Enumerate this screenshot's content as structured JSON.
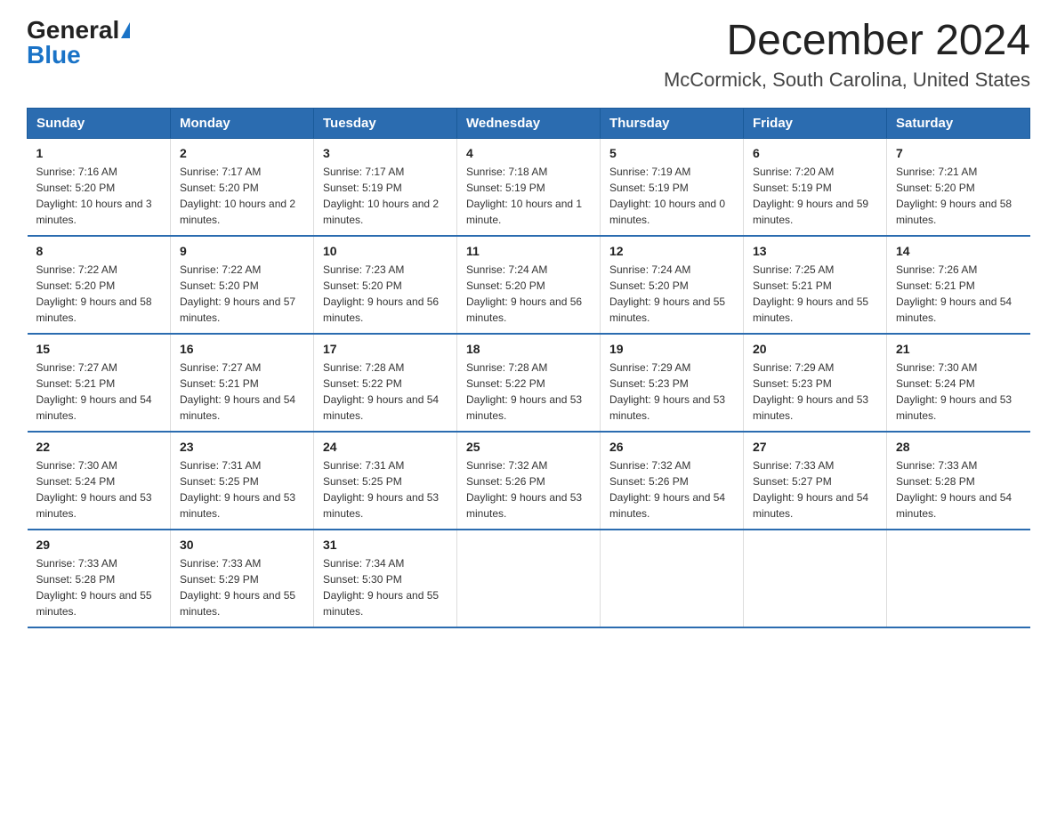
{
  "header": {
    "logo_general": "General",
    "logo_blue": "Blue",
    "month_title": "December 2024",
    "location": "McCormick, South Carolina, United States"
  },
  "weekdays": [
    "Sunday",
    "Monday",
    "Tuesday",
    "Wednesday",
    "Thursday",
    "Friday",
    "Saturday"
  ],
  "weeks": [
    [
      {
        "day": "1",
        "sunrise": "7:16 AM",
        "sunset": "5:20 PM",
        "daylight": "10 hours and 3 minutes."
      },
      {
        "day": "2",
        "sunrise": "7:17 AM",
        "sunset": "5:20 PM",
        "daylight": "10 hours and 2 minutes."
      },
      {
        "day": "3",
        "sunrise": "7:17 AM",
        "sunset": "5:19 PM",
        "daylight": "10 hours and 2 minutes."
      },
      {
        "day": "4",
        "sunrise": "7:18 AM",
        "sunset": "5:19 PM",
        "daylight": "10 hours and 1 minute."
      },
      {
        "day": "5",
        "sunrise": "7:19 AM",
        "sunset": "5:19 PM",
        "daylight": "10 hours and 0 minutes."
      },
      {
        "day": "6",
        "sunrise": "7:20 AM",
        "sunset": "5:19 PM",
        "daylight": "9 hours and 59 minutes."
      },
      {
        "day": "7",
        "sunrise": "7:21 AM",
        "sunset": "5:20 PM",
        "daylight": "9 hours and 58 minutes."
      }
    ],
    [
      {
        "day": "8",
        "sunrise": "7:22 AM",
        "sunset": "5:20 PM",
        "daylight": "9 hours and 58 minutes."
      },
      {
        "day": "9",
        "sunrise": "7:22 AM",
        "sunset": "5:20 PM",
        "daylight": "9 hours and 57 minutes."
      },
      {
        "day": "10",
        "sunrise": "7:23 AM",
        "sunset": "5:20 PM",
        "daylight": "9 hours and 56 minutes."
      },
      {
        "day": "11",
        "sunrise": "7:24 AM",
        "sunset": "5:20 PM",
        "daylight": "9 hours and 56 minutes."
      },
      {
        "day": "12",
        "sunrise": "7:24 AM",
        "sunset": "5:20 PM",
        "daylight": "9 hours and 55 minutes."
      },
      {
        "day": "13",
        "sunrise": "7:25 AM",
        "sunset": "5:21 PM",
        "daylight": "9 hours and 55 minutes."
      },
      {
        "day": "14",
        "sunrise": "7:26 AM",
        "sunset": "5:21 PM",
        "daylight": "9 hours and 54 minutes."
      }
    ],
    [
      {
        "day": "15",
        "sunrise": "7:27 AM",
        "sunset": "5:21 PM",
        "daylight": "9 hours and 54 minutes."
      },
      {
        "day": "16",
        "sunrise": "7:27 AM",
        "sunset": "5:21 PM",
        "daylight": "9 hours and 54 minutes."
      },
      {
        "day": "17",
        "sunrise": "7:28 AM",
        "sunset": "5:22 PM",
        "daylight": "9 hours and 54 minutes."
      },
      {
        "day": "18",
        "sunrise": "7:28 AM",
        "sunset": "5:22 PM",
        "daylight": "9 hours and 53 minutes."
      },
      {
        "day": "19",
        "sunrise": "7:29 AM",
        "sunset": "5:23 PM",
        "daylight": "9 hours and 53 minutes."
      },
      {
        "day": "20",
        "sunrise": "7:29 AM",
        "sunset": "5:23 PM",
        "daylight": "9 hours and 53 minutes."
      },
      {
        "day": "21",
        "sunrise": "7:30 AM",
        "sunset": "5:24 PM",
        "daylight": "9 hours and 53 minutes."
      }
    ],
    [
      {
        "day": "22",
        "sunrise": "7:30 AM",
        "sunset": "5:24 PM",
        "daylight": "9 hours and 53 minutes."
      },
      {
        "day": "23",
        "sunrise": "7:31 AM",
        "sunset": "5:25 PM",
        "daylight": "9 hours and 53 minutes."
      },
      {
        "day": "24",
        "sunrise": "7:31 AM",
        "sunset": "5:25 PM",
        "daylight": "9 hours and 53 minutes."
      },
      {
        "day": "25",
        "sunrise": "7:32 AM",
        "sunset": "5:26 PM",
        "daylight": "9 hours and 53 minutes."
      },
      {
        "day": "26",
        "sunrise": "7:32 AM",
        "sunset": "5:26 PM",
        "daylight": "9 hours and 54 minutes."
      },
      {
        "day": "27",
        "sunrise": "7:33 AM",
        "sunset": "5:27 PM",
        "daylight": "9 hours and 54 minutes."
      },
      {
        "day": "28",
        "sunrise": "7:33 AM",
        "sunset": "5:28 PM",
        "daylight": "9 hours and 54 minutes."
      }
    ],
    [
      {
        "day": "29",
        "sunrise": "7:33 AM",
        "sunset": "5:28 PM",
        "daylight": "9 hours and 55 minutes."
      },
      {
        "day": "30",
        "sunrise": "7:33 AM",
        "sunset": "5:29 PM",
        "daylight": "9 hours and 55 minutes."
      },
      {
        "day": "31",
        "sunrise": "7:34 AM",
        "sunset": "5:30 PM",
        "daylight": "9 hours and 55 minutes."
      },
      null,
      null,
      null,
      null
    ]
  ],
  "labels": {
    "sunrise": "Sunrise:",
    "sunset": "Sunset:",
    "daylight": "Daylight:"
  }
}
